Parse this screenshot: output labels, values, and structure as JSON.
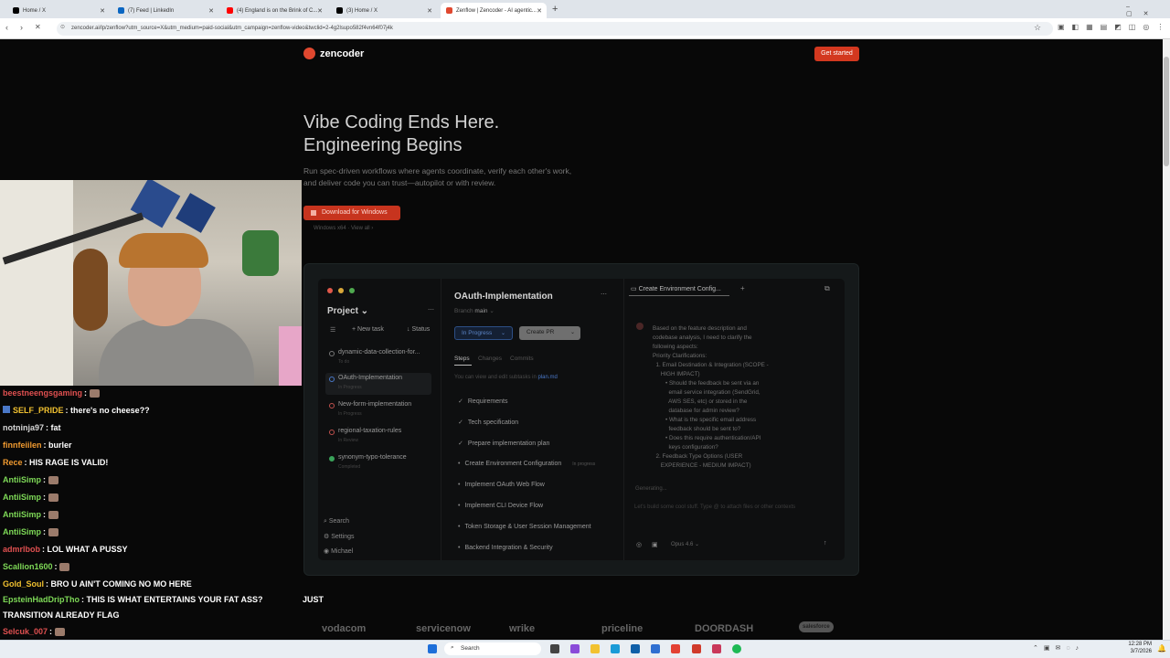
{
  "browser": {
    "tabs": [
      {
        "label": "Home / X",
        "icon_color": "#000000"
      },
      {
        "label": "(7) Feed | LinkedIn",
        "icon_color": "#0a66c2"
      },
      {
        "label": "(4) England is on the Brink of C...",
        "icon_color": "#ff0000"
      },
      {
        "label": "(3) Home / X",
        "icon_color": "#000000"
      },
      {
        "label": "Zenflow | Zencoder - AI agentic...",
        "icon_color": "#e0482f"
      }
    ],
    "new_tab": "+",
    "url": "zencoder.ai/lp/zenflow?utm_source=X&utm_medium=paid-social&utm_campaign=zenflow-video&twclid=2-4g2lsupo582f4vn64f07j4k"
  },
  "site": {
    "logo": "zencoder",
    "cta": "Get started",
    "hero_title_1": "Vibe Coding Ends Here.",
    "hero_title_2": "Engineering Begins",
    "hero_sub_1": "Run spec-driven workflows where agents coordinate, verify each other's work,",
    "hero_sub_2": "and deliver code you can trust—autopilot or with review.",
    "download": "Download for Windows",
    "download_sub": "Windows x64 · View all ›",
    "brands": [
      "vodacom",
      "servicenow",
      "wrike",
      "priceline",
      "DOORDASH",
      "salesforce"
    ]
  },
  "mock": {
    "project_label": "Project",
    "new_task": "New task",
    "status": "Status",
    "projects": [
      {
        "name": "dynamic-data-collection-for...",
        "sub": "To do",
        "color": "#777777"
      },
      {
        "name": "OAuth-Implementation",
        "sub": "In Progress",
        "color": "#4a78c8"
      },
      {
        "name": "New-form-implementation",
        "sub": "In Progress",
        "color": "#c0504d"
      },
      {
        "name": "regional-taxation-rules",
        "sub": "In Review",
        "color": "#c0504d"
      },
      {
        "name": "synonym-typo-tolerance",
        "sub": "Completed",
        "color": "#3aa35a"
      }
    ],
    "bottom_nav": [
      "Search",
      "Settings",
      "Michael"
    ],
    "task_title": "OAuth-Implementation",
    "branch_label": "Branch",
    "branch": "main",
    "status_pill": "In Progress",
    "create_pr": "Create PR",
    "tabs": [
      "Steps",
      "Changes",
      "Commits"
    ],
    "hint_prefix": "You can view and edit subtasks in",
    "hint_file": "plan.md",
    "steps": [
      {
        "label": "Requirements",
        "mark": "✓"
      },
      {
        "label": "Tech specification",
        "mark": "✓"
      },
      {
        "label": "Prepare implementation plan",
        "mark": "✓"
      },
      {
        "label": "Create Environment Configuration",
        "mark": "•",
        "badge": "In progress"
      },
      {
        "label": "Implement OAuth Web Flow",
        "mark": "•"
      },
      {
        "label": "Implement CLI Device Flow",
        "mark": "•"
      },
      {
        "label": "Token Storage & User Session Management",
        "mark": "•"
      },
      {
        "label": "Backend Integration & Security",
        "mark": "•"
      }
    ],
    "chat_tab": "Create Environment Config...",
    "chat_lines": [
      "Based on the feature description and",
      "codebase analysis, I need to clarify the",
      "following aspects:",
      "Priority Clarifications:",
      "  1. Email Destination & Integration (SCOPE -",
      "     HIGH IMPACT)",
      "        • Should the feedback be sent via an",
      "          email service integration (SendGrid,",
      "          AWS SES, etc) or stored in the",
      "          database for admin review?",
      "        • What is the specific email address",
      "          feedback should be sent to?",
      "        • Does this require authentication/API",
      "          keys configuration?",
      "  2. Feedback Type Options (USER",
      "     EXPERIENCE - MEDIUM IMPACT)"
    ],
    "generating": "Generating...",
    "input_placeholder": "Let's build some cool stuff. Type  @  to attach files or other contexts",
    "model": "Opus 4.6"
  },
  "chat": [
    {
      "user": "beestneengsgaming",
      "text": "",
      "color": "#e05050",
      "emote": true
    },
    {
      "user": "SELF_PRIDE",
      "text": "there's no cheese??",
      "color": "#f0c030",
      "badge": true
    },
    {
      "user": "notninja97",
      "text": "fat",
      "color": "#d8d8d8"
    },
    {
      "user": "finnfeiilen",
      "text": "burler",
      "color": "#f09a30"
    },
    {
      "user": "Rece",
      "text": "HIS RAGE IS VALID!",
      "color": "#f09a30"
    },
    {
      "user": "AntiiSimp",
      "text": "",
      "color": "#7ed957",
      "emote": true
    },
    {
      "user": "AntiiSimp",
      "text": "",
      "color": "#7ed957",
      "emote": true
    },
    {
      "user": "AntiiSimp",
      "text": "",
      "color": "#7ed957",
      "emote": true
    },
    {
      "user": "AntiiSimp",
      "text": "",
      "color": "#7ed957",
      "emote": true
    },
    {
      "user": "admrlbob",
      "text": "LOL WHAT A PUSSY",
      "color": "#e05050"
    },
    {
      "user": "Scallion1600",
      "text": "",
      "color": "#7ed957",
      "emote": true
    },
    {
      "user": "Gold_Soul",
      "text": "BRO U AIN'T COMING NO MO HERE",
      "color": "#f0c030"
    },
    {
      "user": "EpsteinHadDripTho",
      "text": "THIS IS WHAT ENTERTAINS YOUR FAT ASS?",
      "color": "#7ed957"
    },
    {
      "user": "",
      "text": "TRANSITION ALREADY FLAG",
      "color": "#ffffff"
    },
    {
      "user": "Selcuk_007",
      "text": "",
      "color": "#e05050",
      "emote": true
    },
    {
      "user": "Selcuk_007",
      "text": "",
      "color": "#e05050",
      "emote": true
    }
  ],
  "chat_extra": "JUST",
  "taskbar": {
    "search": "Search",
    "time": "12:28 PM",
    "date": "3/7/2026"
  }
}
